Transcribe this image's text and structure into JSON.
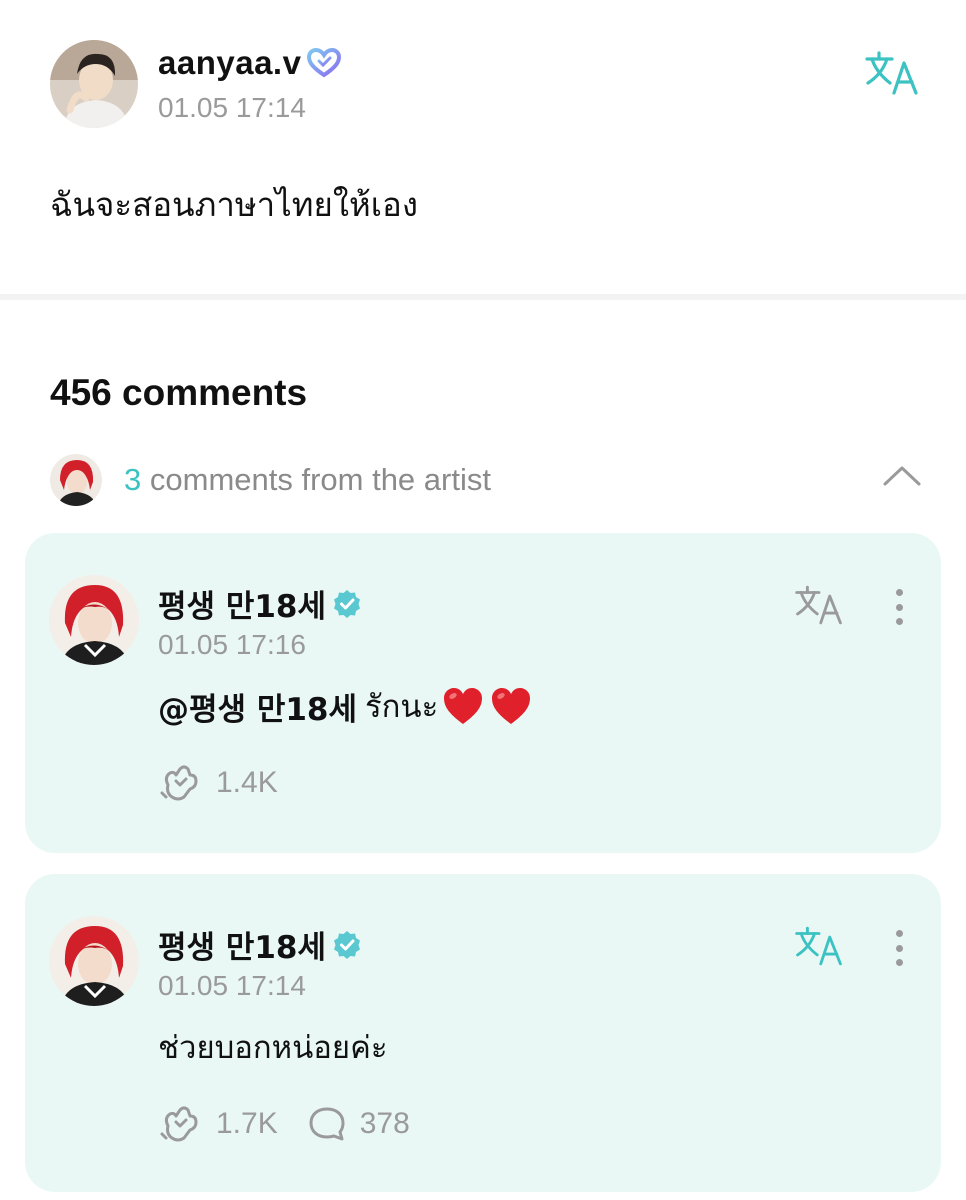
{
  "post": {
    "author": "aanyaa.v",
    "timestamp": "01.05 17:14",
    "text": "ฉันจะสอนภาษาไทยให้เอง",
    "icons": {
      "avatar": "avatar-photo",
      "badge": "heart-badge-icon",
      "translate": "translate-icon"
    }
  },
  "comments_section": {
    "count_label": "456 comments",
    "artist_bar": {
      "count": "3",
      "label": "comments from the artist",
      "icons": {
        "toggle": "chevron-up-icon"
      }
    }
  },
  "comments": [
    {
      "author": "평생 만18세",
      "timestamp": "01.05 17:16",
      "mention": "@평생 만18세",
      "text": "รักนะ",
      "emoji": [
        "❤️",
        "❤️"
      ],
      "likes": "1.4K",
      "replies": null
    },
    {
      "author": "평생 만18세",
      "timestamp": "01.05 17:14",
      "mention": "",
      "text": "ช่วยบอกหน่อยค่ะ",
      "emoji": [],
      "likes": "1.7K",
      "replies": "378"
    }
  ],
  "colors": {
    "accent": "#3cc2c2",
    "card_bg": "#e9f8f5",
    "muted": "#9a9a9a",
    "artist_badge": "#5ac8d0",
    "heart": "#e0212b"
  }
}
